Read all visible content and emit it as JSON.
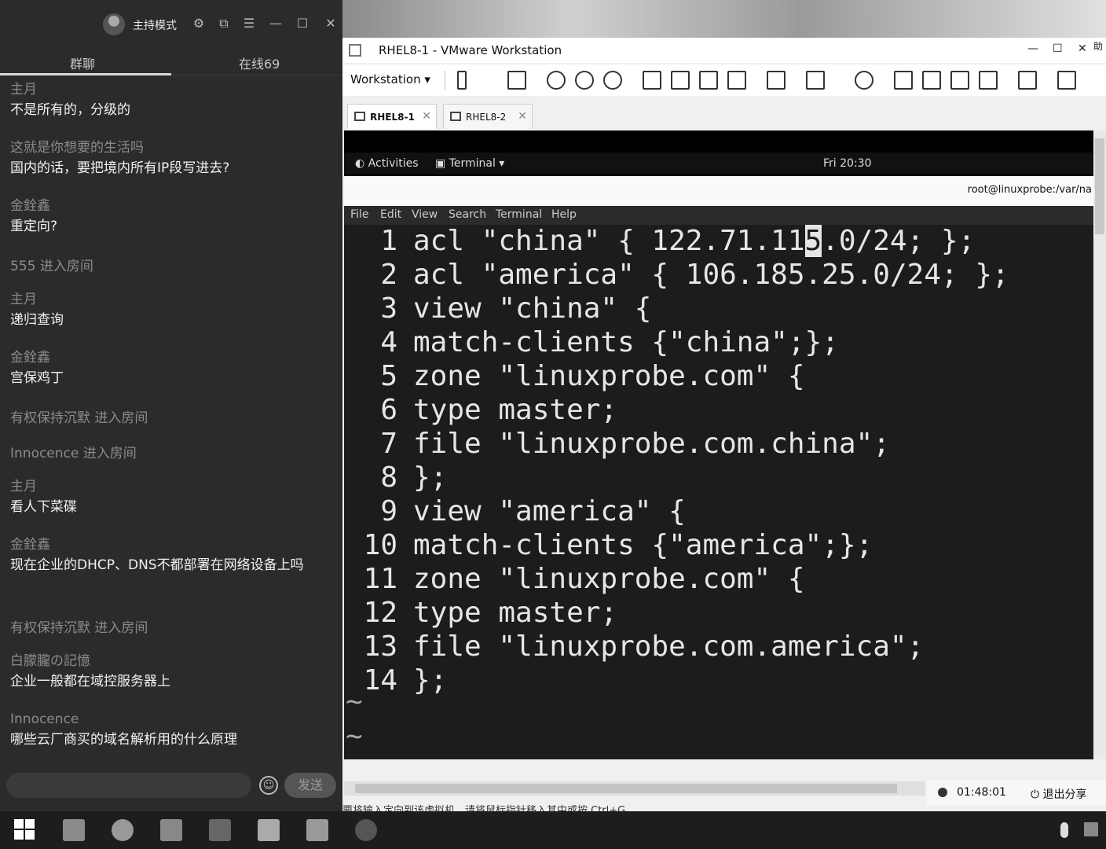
{
  "chat": {
    "mode_label": "主持模式",
    "tabs": [
      "群聊",
      "在线69"
    ],
    "messages": [
      {
        "who": "主月",
        "text": "不是所有的，分级的"
      },
      {
        "who": "这就是你想要的生活吗",
        "text": "国内的话，要把境内所有IP段写进去?"
      },
      {
        "who": "金銓鑫",
        "text": "重定向?"
      },
      {
        "notice": "555 进入房间"
      },
      {
        "who": "主月",
        "text": "递归查询"
      },
      {
        "who": "金銓鑫",
        "text": "宫保鸡丁"
      },
      {
        "notice": "有权保持沉默 进入房间"
      },
      {
        "notice": "Innocence 进入房间"
      },
      {
        "who": "主月",
        "text": "看人下菜碟"
      },
      {
        "who": "金銓鑫",
        "text": "现在企业的DHCP、DNS不都部署在网络设备上吗"
      },
      {
        "notice": "有权保持沉默 进入房间"
      },
      {
        "who": "白朦朧の記憶",
        "text": "企业一般都在域控服务器上"
      },
      {
        "who": "Innocence",
        "text": "哪些云厂商买的域名解析用的什么原理"
      }
    ],
    "send_label": "发送"
  },
  "vmware": {
    "title": "RHEL8-1 - VMware Workstation",
    "workstation_menu": "Workstation",
    "tabs": [
      "RHEL8-1",
      "RHEL8-2"
    ]
  },
  "guest": {
    "activities": "Activities",
    "terminal_menu": "Terminal",
    "clock": "Fri 20:30",
    "terminal_title": "root@linuxprobe:/var/na",
    "menu": [
      "File",
      "Edit",
      "View",
      "Search",
      "Terminal",
      "Help"
    ],
    "code": [
      {
        "n": "1",
        "pre": "acl \"china\" { 122.71.11",
        "cur": "5",
        "post": ".0/24; };"
      },
      {
        "n": "2",
        "pre": "acl \"america\" { 106.185.25.0/24; };",
        "cur": "",
        "post": ""
      },
      {
        "n": "3",
        "pre": "view \"china\" {",
        "cur": "",
        "post": ""
      },
      {
        "n": "4",
        "pre": "match-clients {\"china\";};",
        "cur": "",
        "post": ""
      },
      {
        "n": "5",
        "pre": "zone \"linuxprobe.com\" {",
        "cur": "",
        "post": ""
      },
      {
        "n": "6",
        "pre": "type master;",
        "cur": "",
        "post": ""
      },
      {
        "n": "7",
        "pre": "file \"linuxprobe.com.china\";",
        "cur": "",
        "post": ""
      },
      {
        "n": "8",
        "pre": "};",
        "cur": "",
        "post": ""
      },
      {
        "n": "9",
        "pre": "view \"america\" {",
        "cur": "",
        "post": ""
      },
      {
        "n": "10",
        "pre": "match-clients {\"america\";};",
        "cur": "",
        "post": ""
      },
      {
        "n": "11",
        "pre": "zone \"linuxprobe.com\" {",
        "cur": "",
        "post": ""
      },
      {
        "n": "12",
        "pre": "type master;",
        "cur": "",
        "post": ""
      },
      {
        "n": "13",
        "pre": "file \"linuxprobe.com.america\";",
        "cur": "",
        "post": ""
      },
      {
        "n": "14",
        "pre": "};",
        "cur": "",
        "post": ""
      }
    ],
    "tilde": "~"
  },
  "recording": {
    "time": "01:48:01",
    "exit_label": "退出分享"
  },
  "status_message": "要将输入定向到该虚拟机，请将鼠标指针移入其中或按 Ctrl+G。",
  "edge_text": "助"
}
